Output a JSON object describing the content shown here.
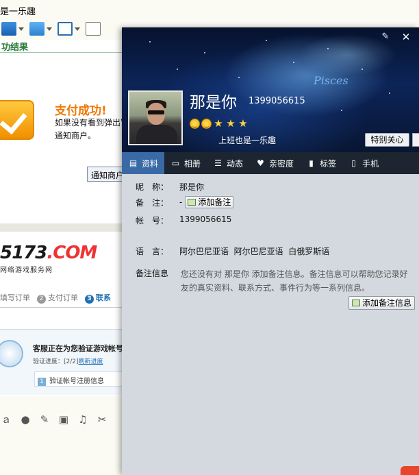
{
  "background_window": {
    "title": "是一乐趣",
    "header_green": "功结果",
    "payment_success": "支付成功!",
    "hint_line1": "如果没有看到弹出窗口",
    "hint_line2": "通知商户。",
    "notify_button": "通知商户",
    "logo_main": "5173",
    "logo_com": ".COM",
    "logo_sub": "网络游戏服务网",
    "steps": [
      {
        "num": "",
        "label": "填写订单"
      },
      {
        "num": "2",
        "label": "支付订单"
      },
      {
        "num": "3",
        "label": "联系"
      }
    ],
    "verify_title": "客服正在为您验证游戏帐号",
    "verify_progress_label": "验证进度：[2/2]",
    "verify_refresh": "刷新进度",
    "verify_step_num": "1",
    "verify_step_text": "验证帐号注册信息"
  },
  "profile": {
    "banner_text": "Pisces",
    "nickname": "那是你",
    "qq_number": "1399056615",
    "signature": "上班也是一乐趣",
    "special_care_button": "特别关心",
    "tabs": [
      {
        "label": "资料",
        "icon": "profile-card-icon",
        "active": true
      },
      {
        "label": "相册",
        "icon": "album-icon",
        "active": false
      },
      {
        "label": "动态",
        "icon": "feed-icon",
        "active": false
      },
      {
        "label": "亲密度",
        "icon": "heart-icon",
        "active": false
      },
      {
        "label": "标签",
        "icon": "bookmark-icon",
        "active": false
      },
      {
        "label": "手机",
        "icon": "phone-icon",
        "active": false
      }
    ],
    "fields": {
      "nickname_label": "昵　称：",
      "nickname_value": "那是你",
      "remark_label": "备　注：",
      "remark_value": "-",
      "add_remark_button": "添加备注",
      "account_label": "帐　号：",
      "account_value": "1399056615",
      "language_label": "语　言：",
      "language_value": "阿尔巴尼亚语  阿尔巴尼亚语  白俄罗斯语",
      "note_info_label": "备注信息",
      "note_info_text": "您还没有对 那是你 添加备注信息。备注信息可以帮助您记录好友的真实资料、联系方式、事件行为等一系列信息。",
      "add_note_info_button": "添加备注信息"
    }
  }
}
